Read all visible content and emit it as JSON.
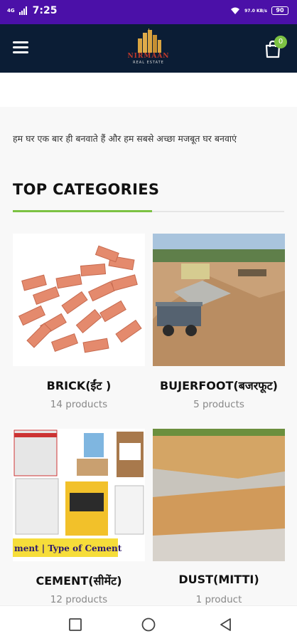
{
  "status_bar": {
    "time": "7:25",
    "network_left": "4G",
    "speed": "97.0 KB/s",
    "battery": "90"
  },
  "header": {
    "logo_name": "NIRMAAN",
    "logo_sub": "REAL ESTATE",
    "menu_icon": "hamburger-icon",
    "cart_icon": "shopping-bag-icon",
    "cart_count": "0"
  },
  "main": {
    "tagline": "हम घर एक बार ही बनवाते हैं और हम सबसे अच्छा मजबूत घर बनवाएं",
    "section_title": "TOP CATEGORIES",
    "categories": [
      {
        "name": "BRICK(ईंट )",
        "count": "14 products"
      },
      {
        "name": "BUJERFOOT(बजरफूट)",
        "count": "5 products"
      },
      {
        "name": "CEMENT(सीमेंट)",
        "count": "12 products",
        "banner": "ment | Type of Cement"
      },
      {
        "name": "DUST(MITTI)",
        "count": "1 product"
      }
    ]
  },
  "colors": {
    "status_bar": "#4b10a8",
    "header": "#0b1d35",
    "accent": "#7cc243"
  }
}
